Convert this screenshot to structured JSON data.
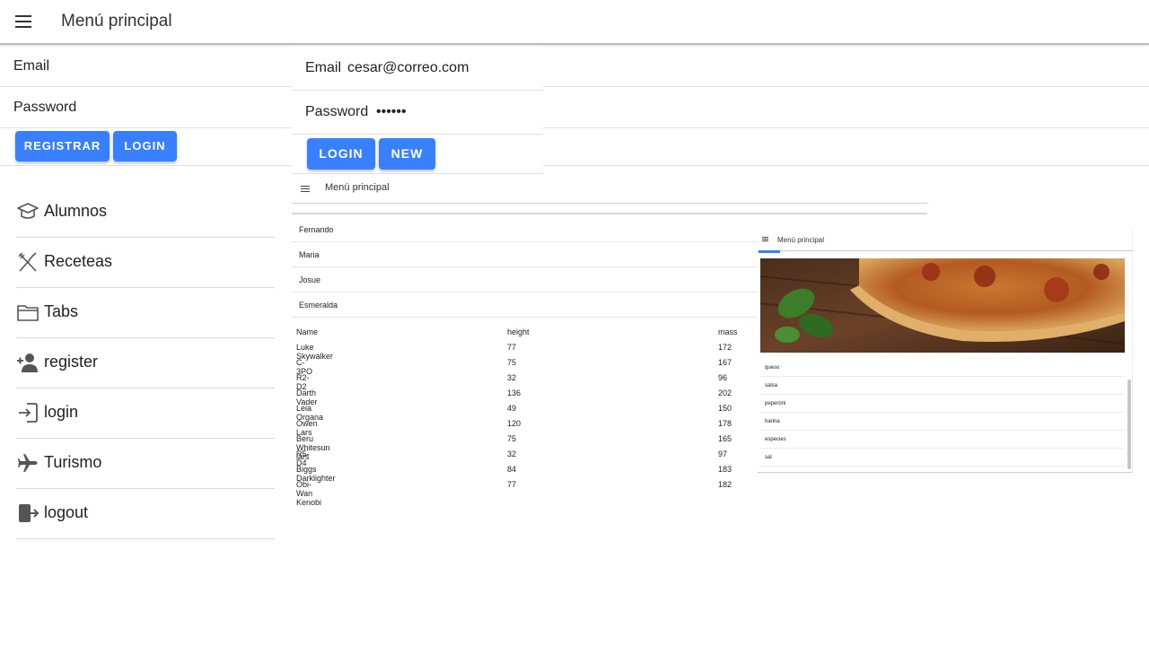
{
  "header": {
    "title": "Menú principal",
    "menu_icon": "hamburger-menu-icon"
  },
  "login_form": {
    "email_label": "Email",
    "password_label": "Password",
    "register_button": "REGISTRAR",
    "login_button": "LOGIN"
  },
  "sidebar": {
    "items": [
      {
        "label": "Alumnos",
        "icon": "graduation-cap-icon"
      },
      {
        "label": "Receteas",
        "icon": "utensils-icon"
      },
      {
        "label": "Tabs",
        "icon": "folder-icon"
      },
      {
        "label": "register",
        "icon": "person-add-icon"
      },
      {
        "label": "login",
        "icon": "login-icon"
      },
      {
        "label": "Turismo",
        "icon": "airplane-icon"
      },
      {
        "label": "logout",
        "icon": "logout-icon"
      }
    ]
  },
  "login_panel": {
    "email_label": "Email",
    "email_value": "cesar@correo.com",
    "password_label": "Password",
    "password_value": "••••••",
    "login_button": "LOGIN",
    "new_button": "NEW"
  },
  "mini_menu": {
    "title": "Menú principal"
  },
  "names": [
    "Fernando",
    "Maria",
    "Josue",
    "Esmeralda"
  ],
  "people_table": {
    "headers": [
      "Name",
      "height",
      "mass"
    ],
    "rows": [
      [
        "Luke Skywalker",
        "77",
        "172"
      ],
      [
        "C-3PO",
        "75",
        "167"
      ],
      [
        "R2-D2",
        "32",
        "96"
      ],
      [
        "Darth Vader",
        "136",
        "202"
      ],
      [
        "Leia Organa",
        "49",
        "150"
      ],
      [
        "Owen Lars",
        "120",
        "178"
      ],
      [
        "Beru Whitesun lars",
        "75",
        "165"
      ],
      [
        "R5-D4",
        "32",
        "97"
      ],
      [
        "Biggs Darklighter",
        "84",
        "183"
      ],
      [
        "Obi-Wan Kenobi",
        "77",
        "182"
      ]
    ]
  },
  "pizza_card": {
    "title": "Menú principal",
    "ingredients": [
      "queso",
      "salsa",
      "peperoni",
      "harina",
      "especies",
      "sal"
    ]
  },
  "colors": {
    "primary": "#3880ff"
  }
}
